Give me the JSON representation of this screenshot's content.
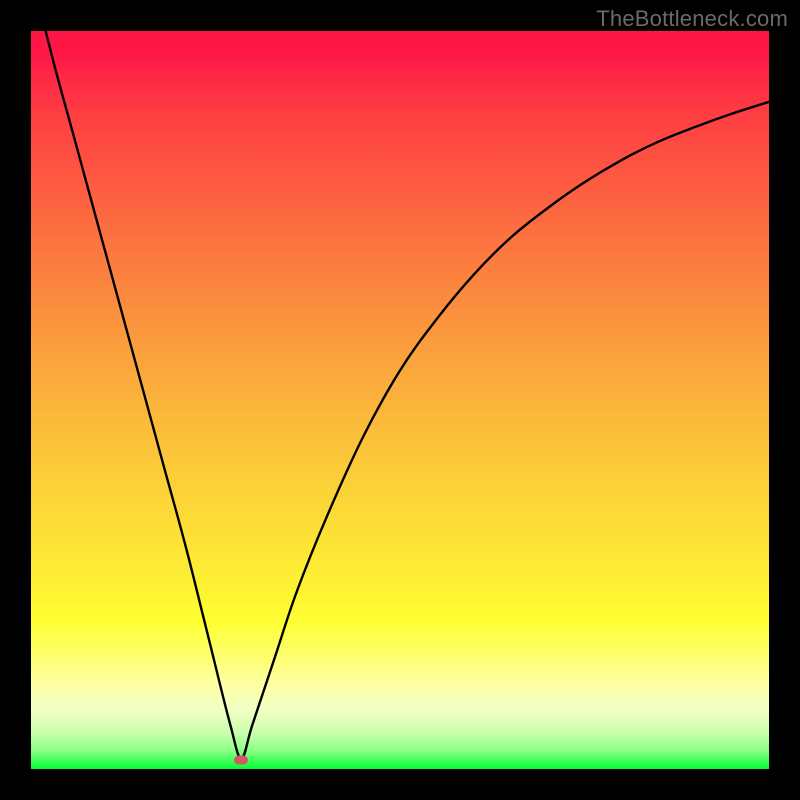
{
  "watermark": "TheBottleneck.com",
  "colors": {
    "frame": "#000000",
    "curve": "#000000",
    "marker": "#cf5a64"
  },
  "chart_data": {
    "type": "line",
    "title": "",
    "xlabel": "",
    "ylabel": "",
    "xlim": [
      0,
      100
    ],
    "ylim": [
      0,
      100
    ],
    "grid": false,
    "legend": false,
    "background_gradient": {
      "top_color": "#fe1745",
      "bottom_color": "#00ff36",
      "description": "vertical rainbow gradient: red (high bottleneck) at top through orange, yellow to green (no bottleneck) at bottom"
    },
    "series": [
      {
        "name": "bottleneck-curve",
        "comment": "x is normalized GPU/CPU balance; y is bottleneck severity %. V-shaped dip, minimum near x≈28.",
        "x": [
          0,
          3,
          6,
          9,
          12,
          15,
          18,
          21,
          24,
          27,
          28.5,
          30,
          33,
          36,
          40,
          45,
          50,
          55,
          60,
          65,
          70,
          75,
          80,
          85,
          90,
          95,
          100
        ],
        "y": [
          108,
          96,
          85,
          74,
          63,
          52,
          41,
          30,
          18,
          6,
          1.5,
          6,
          15,
          24,
          34,
          45,
          54,
          61,
          67,
          72,
          76,
          79.5,
          82.5,
          85,
          87,
          88.8,
          90.4
        ]
      }
    ],
    "marker": {
      "x": 28.5,
      "y": 1.2,
      "shape": "rounded-rect"
    }
  }
}
